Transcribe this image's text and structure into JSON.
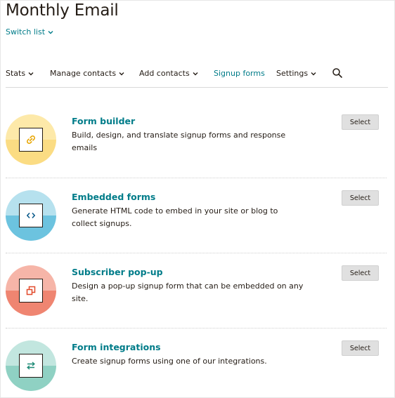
{
  "header": {
    "title": "Monthly Email",
    "switch_list_label": "Switch list"
  },
  "nav": {
    "items": [
      {
        "label": "Stats",
        "has_dropdown": true,
        "active": false
      },
      {
        "label": "Manage contacts",
        "has_dropdown": true,
        "active": false
      },
      {
        "label": "Add contacts",
        "has_dropdown": true,
        "active": false
      },
      {
        "label": "Signup forms",
        "has_dropdown": false,
        "active": true
      },
      {
        "label": "Settings",
        "has_dropdown": true,
        "active": false
      }
    ],
    "search_icon": "search-icon"
  },
  "forms": [
    {
      "title": "Form builder",
      "description": "Build, design, and translate signup forms and response emails",
      "button_label": "Select",
      "icon": "link-icon",
      "colors": {
        "top": "#fde9a9",
        "bottom": "#fbdc83",
        "icon": "#e8a500"
      }
    },
    {
      "title": "Embedded forms",
      "description": "Generate HTML code to embed in your site or blog to collect signups.",
      "button_label": "Select",
      "icon": "code-icon",
      "colors": {
        "top": "#b6e1ee",
        "bottom": "#6cc3df",
        "icon": "#0a5a8a"
      }
    },
    {
      "title": "Subscriber pop-up",
      "description": "Design a pop-up signup form that can be embedded on any site.",
      "button_label": "Select",
      "icon": "popup-icon",
      "colors": {
        "top": "#f6b5a8",
        "bottom": "#ef8571",
        "icon": "#e24a2c"
      }
    },
    {
      "title": "Form integrations",
      "description": "Create signup forms using one of our integrations.",
      "button_label": "Select",
      "icon": "swap-arrows-icon",
      "colors": {
        "top": "#c2e6df",
        "bottom": "#8fd1c3",
        "icon": "#1e8b77"
      }
    }
  ],
  "colors": {
    "accent": "#007c89",
    "text": "#241c15"
  }
}
